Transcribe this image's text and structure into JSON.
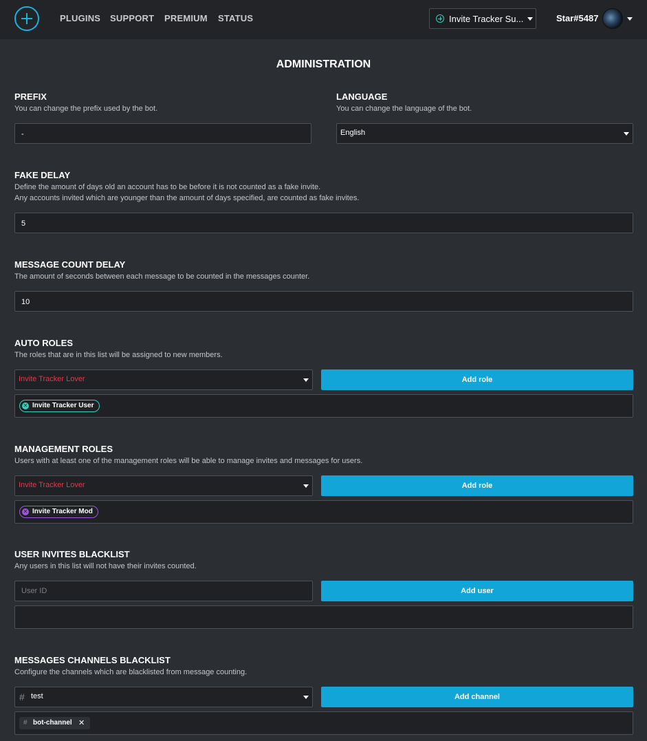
{
  "nav": {
    "links": [
      "PLUGINS",
      "SUPPORT",
      "PREMIUM",
      "STATUS"
    ],
    "server": "Invite Tracker Su...",
    "user": "Star#5487"
  },
  "page": {
    "title": "ADMINISTRATION"
  },
  "prefix": {
    "title": "PREFIX",
    "desc": "You can change the prefix used by the bot.",
    "value": "-"
  },
  "language": {
    "title": "LANGUAGE",
    "desc": "You can change the language of the bot.",
    "value": "English"
  },
  "fake_delay": {
    "title": "FAKE DELAY",
    "desc1": "Define the amount of days old an account has to be before it is not counted as a fake invite.",
    "desc2": "Any accounts invited which are younger than the amount of days specified, are counted as fake invites.",
    "value": "5"
  },
  "message_count_delay": {
    "title": "MESSAGE COUNT DELAY",
    "desc": "The amount of seconds between each message to be counted in the messages counter.",
    "value": "10"
  },
  "auto_roles": {
    "title": "AUTO ROLES",
    "desc": "The roles that are in this list will be assigned to new members.",
    "selected": "Invite Tracker Lover",
    "button": "Add role",
    "chips": [
      {
        "label": "Invite Tracker User",
        "color": "#2fd3bc"
      }
    ]
  },
  "management_roles": {
    "title": "MANAGEMENT ROLES",
    "desc": "Users with at least one of the management roles will be able to manage invites and messages for users.",
    "selected": "Invite Tracker Lover",
    "button": "Add role",
    "chips": [
      {
        "label": "Invite Tracker Mod",
        "color": "#9b59d6"
      }
    ]
  },
  "user_blacklist": {
    "title": "USER INVITES BLACKLIST",
    "desc": "Any users in this list will not have their invites counted.",
    "placeholder": "User ID",
    "button": "Add user"
  },
  "channel_blacklist": {
    "title": "MESSAGES CHANNELS BLACKLIST",
    "desc": "Configure the channels which are blacklisted from message counting.",
    "hash": "#",
    "selected": "test",
    "button": "Add channel",
    "chips": [
      "bot-channel"
    ],
    "chip_remove": "✕"
  },
  "colors": {
    "accent": "#12a6d8",
    "role_red": "#e0394f",
    "background": "#2b2e33",
    "nav_background": "#222428"
  }
}
